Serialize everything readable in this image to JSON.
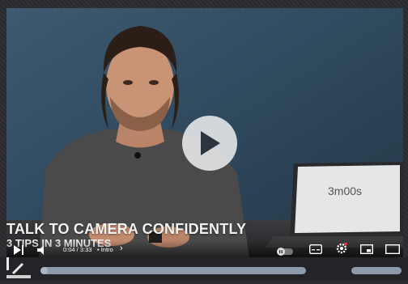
{
  "video": {
    "overlay_title": "TALK TO CAMERA CONFIDENTLY",
    "overlay_subtitle": "3 TIPS IN 3 MINUTES",
    "laptop_screen_text": "3m00s"
  },
  "controls": {
    "time": "0:04 / 3:33",
    "chapter": "• Intro",
    "chapter_chevron": "›",
    "play_icon": "play-icon",
    "volume_icon": "volume-icon",
    "pause_toggle_icon": "autoplay-toggle-icon",
    "captions_icon": "captions-icon",
    "settings_icon": "settings-icon",
    "miniplayer_icon": "miniplayer-icon",
    "theater_icon": "theater-icon"
  },
  "progress": {
    "played_fraction": 0.012
  },
  "colors": {
    "progress_track": "#8d9aab",
    "play_overlay": "#ffffff",
    "wall": "#2c4152"
  }
}
